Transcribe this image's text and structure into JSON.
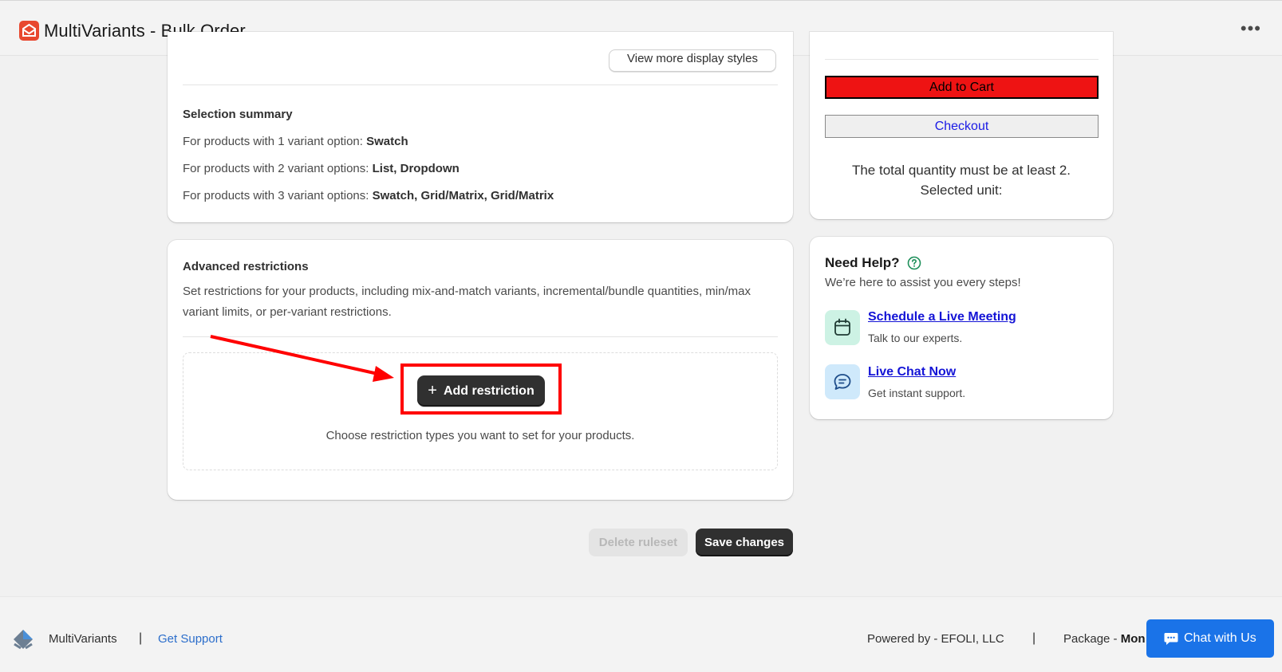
{
  "app": {
    "title": "MultiVariants - Bulk Order",
    "more_icon": "more-horizontal-icon"
  },
  "display_styles": {
    "view_more_label": "View more display styles"
  },
  "selection_summary": {
    "title": "Selection summary",
    "lines": [
      {
        "prefix": "For products with 1 variant option:",
        "value": "Swatch"
      },
      {
        "prefix": "For products with 2 variant options:",
        "value": "List, Dropdown"
      },
      {
        "prefix": "For products with 3 variant options:",
        "value": "Swatch, Grid/Matrix, Grid/Matrix"
      }
    ]
  },
  "advanced_restrictions": {
    "title": "Advanced restrictions",
    "description": "Set restrictions for your products, including mix-and-match variants, incremental/bundle quantities, min/max variant limits, or per-variant restrictions.",
    "add_button_label": "Add restriction",
    "empty_hint": "Choose restriction types you want to set for your products."
  },
  "actions": {
    "delete_label": "Delete ruleset",
    "save_label": "Save changes"
  },
  "cart_preview": {
    "add_to_cart_label": "Add to Cart",
    "checkout_label": "Checkout",
    "note_line1": "The total quantity must be at least 2.",
    "note_line2": "Selected unit:",
    "colors": {
      "add_to_cart_bg": "#ee1313",
      "checkout_text": "#1a1ae6"
    }
  },
  "help": {
    "title": "Need Help?",
    "subtitle": "We’re here to assist you every steps!",
    "items": [
      {
        "link": "Schedule a Live Meeting",
        "desc": "Talk to our experts.",
        "icon": "calendar-icon"
      },
      {
        "link": "Live Chat Now",
        "desc": "Get instant support.",
        "icon": "chat-bubble-icon"
      }
    ]
  },
  "footer": {
    "brand": "MultiVariants",
    "separator": "|",
    "support_label": "Get Support",
    "powered_by": "Powered by - EFOLI, LLC",
    "package_label": "Package - ",
    "package_value": "Mon"
  },
  "chat": {
    "label": "Chat with Us"
  },
  "colors": {
    "accent_red": "#ff0000",
    "primary_dark": "#303030",
    "link_blue": "#2c6ecb",
    "chat_blue": "#1a73e8"
  }
}
